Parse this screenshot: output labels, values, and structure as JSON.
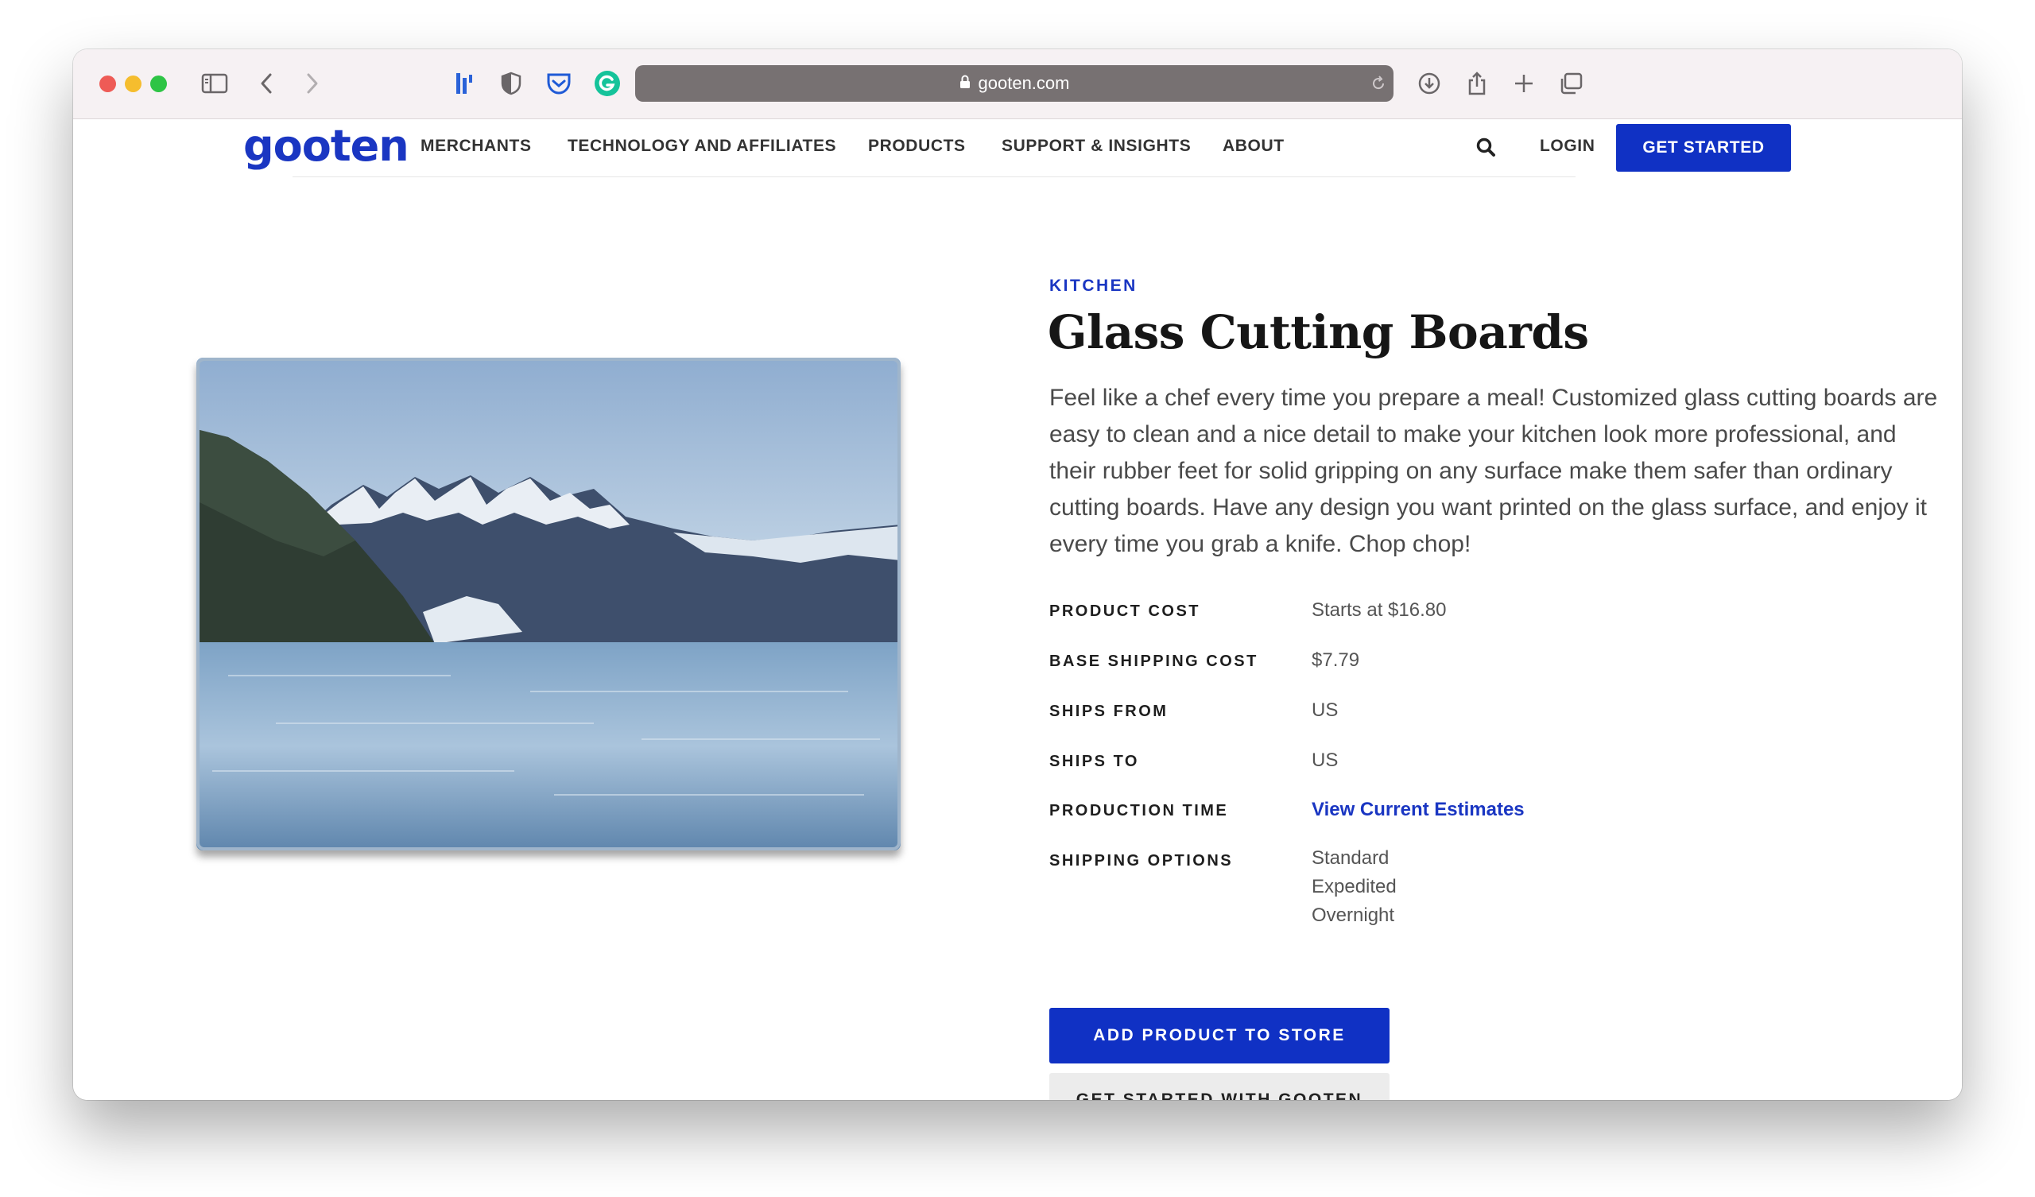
{
  "browser": {
    "url": "gooten.com",
    "traffic_lights": {
      "close": "#ee5b56",
      "minimize": "#f5bd2e",
      "maximize": "#2ec445"
    },
    "icons": [
      "sidebar-icon",
      "back-icon",
      "forward-icon",
      "bookmark-extension-icon",
      "shield-icon",
      "pocket-icon",
      "grammarly-icon",
      "lock-icon",
      "reload-icon",
      "download-icon",
      "share-icon",
      "new-tab-icon",
      "tabs-overview-icon"
    ]
  },
  "nav": {
    "logo": "gooten",
    "items": [
      "MERCHANTS",
      "TECHNOLOGY AND AFFILIATES",
      "PRODUCTS",
      "SUPPORT & INSIGHTS",
      "ABOUT"
    ],
    "login": "LOGIN",
    "cta": "GET STARTED"
  },
  "product": {
    "category": "KITCHEN",
    "title": "Glass Cutting Boards",
    "description": "Feel like a chef every time you prepare a meal! Customized glass cutting boards are easy to clean and a nice detail to make your kitchen look more professional, and their rubber feet for solid gripping on any surface make them safer than ordinary cutting boards. Have any design you want printed on the glass surface, and enjoy it every time you grab a knife. Chop chop!",
    "specs": {
      "product_cost": {
        "label": "PRODUCT COST",
        "value": "Starts at $16.80"
      },
      "base_shipping": {
        "label": "BASE SHIPPING COST",
        "value": "$7.79"
      },
      "ships_from": {
        "label": "SHIPS FROM",
        "value": "US"
      },
      "ships_to": {
        "label": "SHIPS TO",
        "value": "US"
      },
      "production_time": {
        "label": "PRODUCTION TIME",
        "value": "View Current Estimates"
      },
      "shipping_options": {
        "label": "SHIPPING OPTIONS",
        "values": [
          "Standard",
          "Expedited",
          "Overnight"
        ]
      }
    },
    "add_button": "ADD PRODUCT TO STORE",
    "secondary_button": "GET STARTED WITH GOOTEN"
  },
  "colors": {
    "brand": "#1031c4",
    "link": "#1a36c2"
  }
}
